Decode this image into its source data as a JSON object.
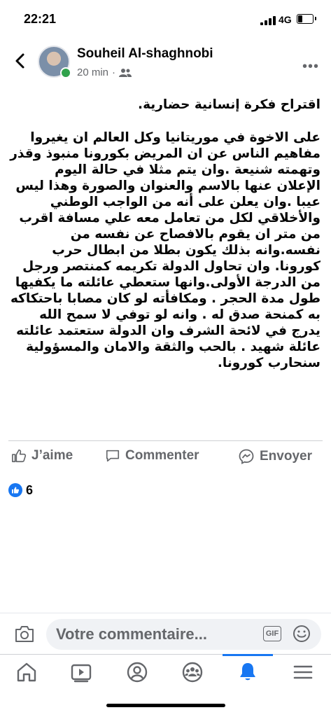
{
  "status_bar": {
    "time": "22:21",
    "network": "4G",
    "battery_level": 0.35
  },
  "header": {
    "back_icon": "chevron-left-icon",
    "author": "Souheil Al-shaghnobi",
    "time_ago": "20 min",
    "separator": "·",
    "audience_icon": "friends-icon",
    "more_icon": "more-dots-icon",
    "more_label": "•••"
  },
  "post": {
    "title": "اقتراح فكرة إنسانية حضارية.",
    "body": "على الاخوة في موريتانيا وكل العالم ان يغيروا مفاهيم الناس عن ان المريض بكورونا منبوذ وقذر وتهمته شنيعة .وان يتم مثلا في حالة اليوم الإعلان عنها بالاسم والعنوان والصورة وهذا ليس عيبا .وان يعلن على أنه من الواجب الوطني والأخلاقي لكل من تعامل معه علي مسافة اقرب من متر ان يقوم بالافصاح عن نفسه من نفسه.وانه بذلك يكون بطلا من ابطال حرب كورونا. وان تحاول الدولة تكريمه كمنتصر ورجل من الدرجة الأولى.وانها ستعطي عائلته ما يكفيها طول مدة الحجر . ومكافأته لو كان مصابا باحتكاكه به كمنحة صدق له . وانه لو توفي لا سمح الله يدرج في لائحة الشرف وان الدولة ستعتمد عائلته عائلة شهيد . بالحب والثقة والامان والمسؤولية سنحارب كورونا."
  },
  "actions": {
    "like": "J’aime",
    "comment": "Commenter",
    "send": "Envoyer"
  },
  "reactions": {
    "icon": "like-reaction-icon",
    "count": "6"
  },
  "comment_bar": {
    "camera_icon": "camera-icon",
    "placeholder": "Votre commentaire...",
    "gif_label": "GIF",
    "emoji_icon": "emoji-icon"
  },
  "bottom_nav": {
    "items": [
      "home-icon",
      "watch-icon",
      "profile-icon",
      "groups-icon",
      "notifications-icon",
      "menu-icon"
    ],
    "active": "notifications-icon"
  },
  "colors": {
    "accent": "#1877f2",
    "secondary_text": "#65676b",
    "online": "#31a24c"
  }
}
